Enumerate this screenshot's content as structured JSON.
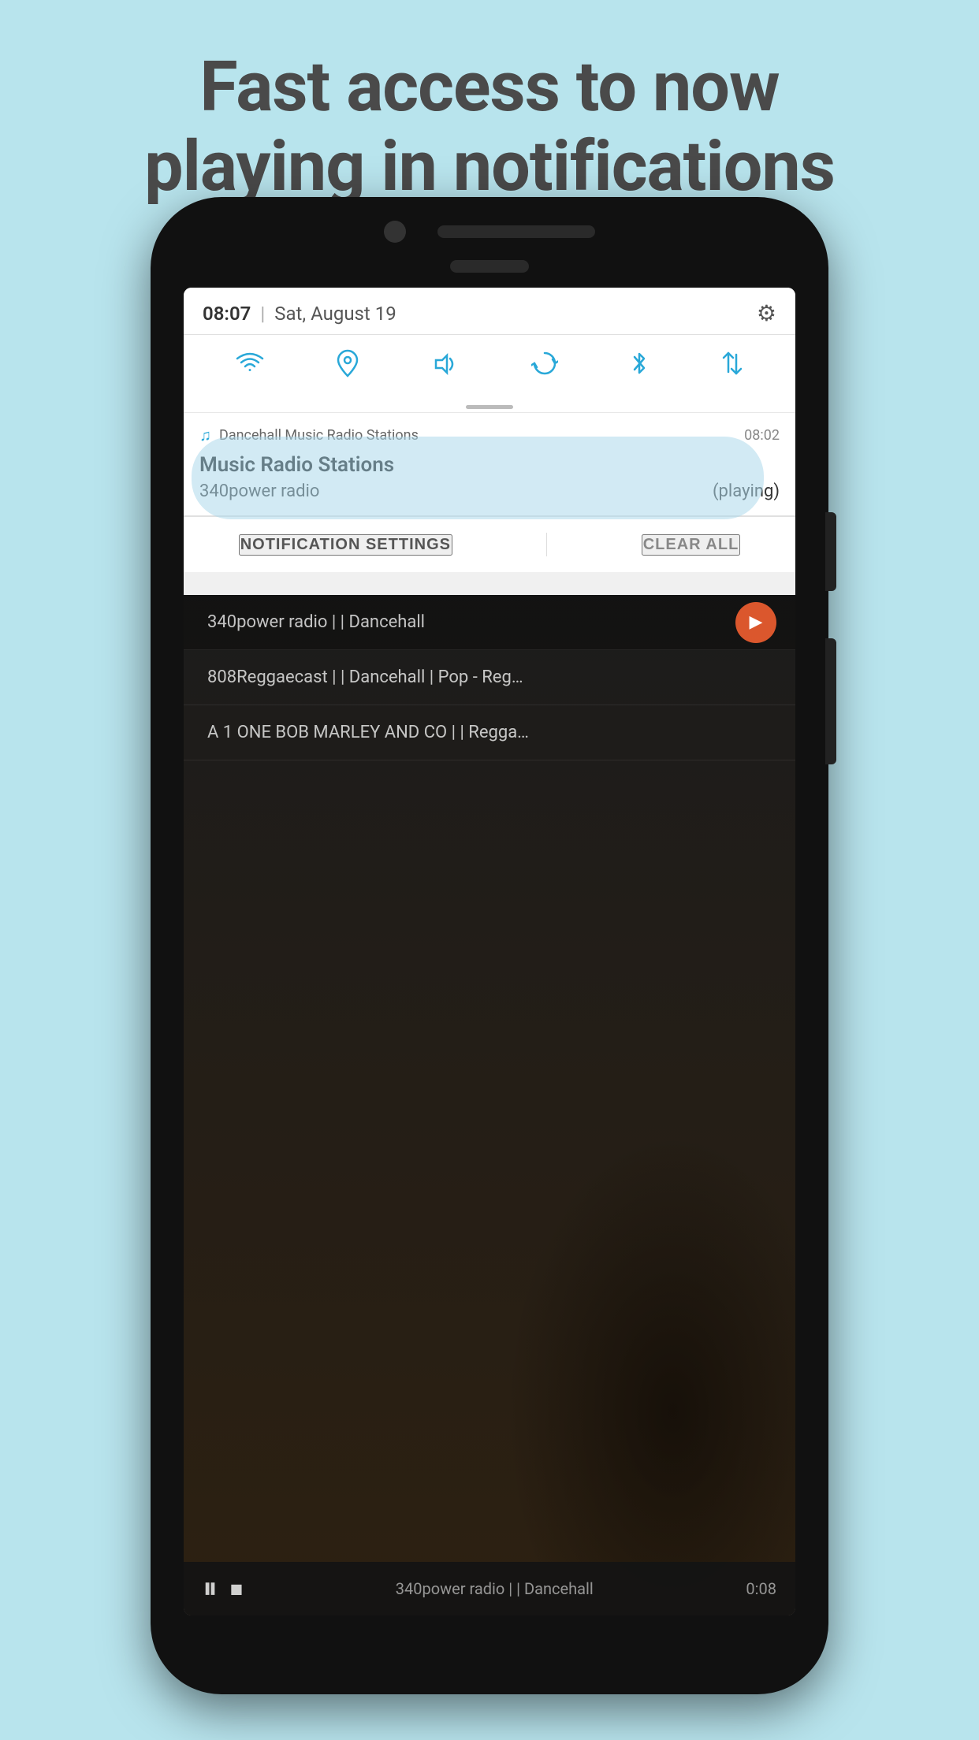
{
  "header": {
    "line1": "Fast access to now",
    "line2": "playing in notifications"
  },
  "phone": {
    "status_bar": {
      "time": "08:07",
      "divider": "|",
      "date": "Sat, August 19",
      "gear_icon": "⚙"
    },
    "quick_settings": {
      "icons": [
        "wifi",
        "location",
        "volume",
        "sync",
        "bluetooth",
        "data"
      ]
    },
    "notification": {
      "app_icon": "♫",
      "app_name": "Dancehall Music Radio Stations",
      "notif_time": "08:02",
      "title": "Music Radio Stations",
      "station": "340power radio",
      "status": "(playing)"
    },
    "actions": {
      "settings_label": "NOTIFICATION SETTINGS",
      "clear_label": "CLEAR ALL"
    },
    "station_list": [
      {
        "name": "340power radio | | Dancehall",
        "active": true
      },
      {
        "name": "808Reggaecast | | Dancehall | Pop - Reg…",
        "active": false
      },
      {
        "name": "A 1 ONE BOB MARLEY AND CO | | Regga…",
        "active": false
      }
    ],
    "player": {
      "station": "340power radio | | Dancehall",
      "time": "0:08"
    }
  }
}
